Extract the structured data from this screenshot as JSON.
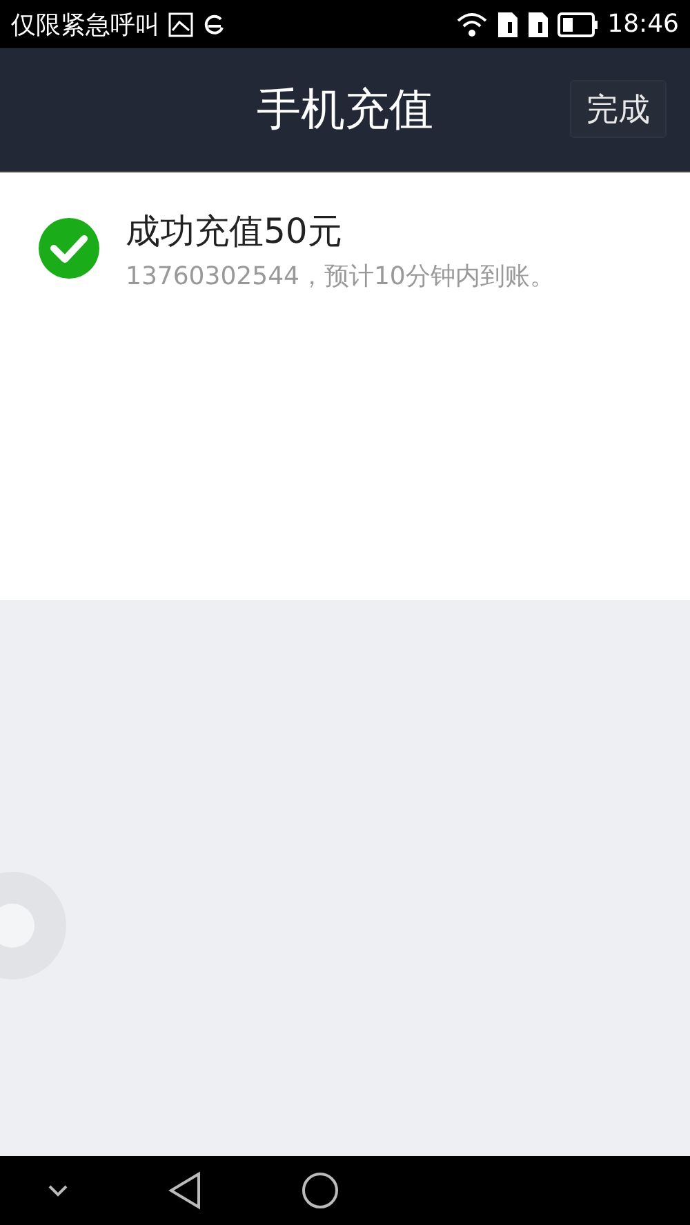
{
  "status_bar": {
    "carrier": "仅限紧急呼叫",
    "time": "18:46"
  },
  "header": {
    "title": "手机充值",
    "done_button": "完成"
  },
  "result": {
    "title": "成功充值50元",
    "detail": "13760302544，预计10分钟内到账。"
  }
}
